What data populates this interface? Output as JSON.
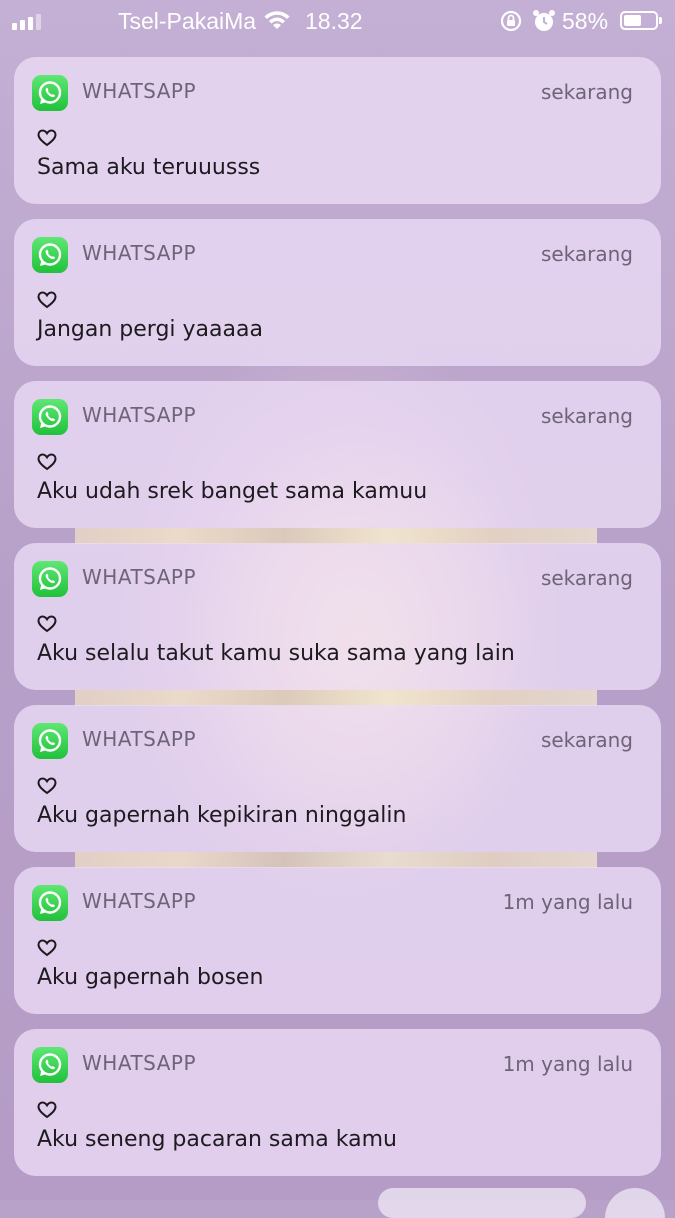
{
  "status_bar": {
    "carrier": "Tsel-PakaiMasker",
    "time": "18.32",
    "battery_pct": "58%",
    "battery_level": 0.58,
    "signal_bars_active": 3,
    "signal_bars_total": 4,
    "icons": [
      "signal-icon",
      "wifi-icon",
      "rotation-lock-icon",
      "alarm-icon",
      "battery-icon"
    ]
  },
  "notifications": [
    {
      "app": "WHATSAPP",
      "time": "sekarang",
      "sender_icon": "heart-icon",
      "message": "Sama aku teruuusss"
    },
    {
      "app": "WHATSAPP",
      "time": "sekarang",
      "sender_icon": "heart-icon",
      "message": "Jangan pergi yaaaaa"
    },
    {
      "app": "WHATSAPP",
      "time": "sekarang",
      "sender_icon": "heart-icon",
      "message": "Aku udah srek banget sama kamuu"
    },
    {
      "app": "WHATSAPP",
      "time": "sekarang",
      "sender_icon": "heart-icon",
      "message": "Aku selalu takut kamu suka sama yang lain"
    },
    {
      "app": "WHATSAPP",
      "time": "sekarang",
      "sender_icon": "heart-icon",
      "message": "Aku gapernah kepikiran ninggalin"
    },
    {
      "app": "WHATSAPP",
      "time": "1m yang lalu",
      "sender_icon": "heart-icon",
      "message": "Aku gapernah bosen"
    },
    {
      "app": "WHATSAPP",
      "time": "1m yang lalu",
      "sender_icon": "heart-icon",
      "message": "Aku seneng pacaran sama kamu"
    }
  ],
  "colors": {
    "whatsapp_green": "#25d366",
    "card_background": "#ecdcf6",
    "wallpaper": "#b9a2c9"
  }
}
